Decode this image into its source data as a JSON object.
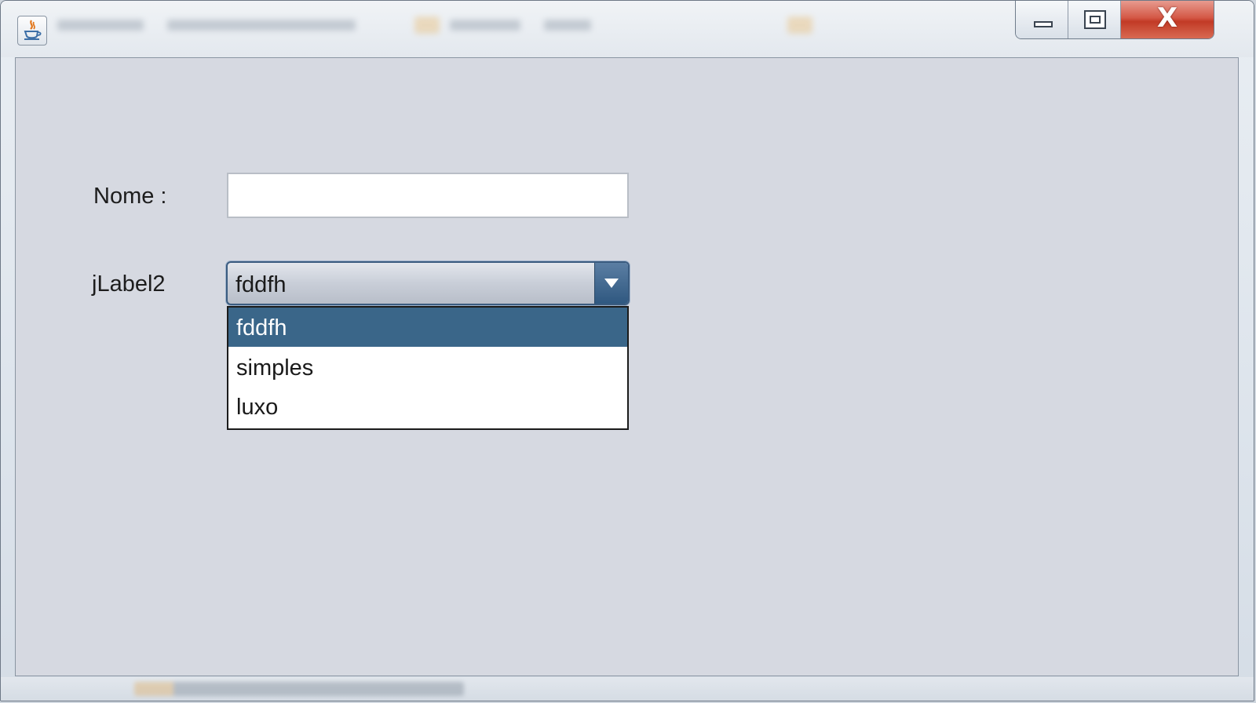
{
  "window": {
    "title": "",
    "caption_buttons": {
      "minimize": "minimize-icon",
      "maximize": "maximize-icon",
      "close": "close-icon",
      "close_symbol": "X"
    }
  },
  "form": {
    "name_label": "Nome :",
    "name_value": "",
    "combo_label": "jLabel2",
    "combo_selected": "fddfh",
    "combo_options": [
      "fddfh",
      "simples",
      "luxo"
    ],
    "highlighted_option": "fddfh"
  },
  "colors": {
    "panel_background": "#d6d9e1",
    "selection_background": "#3a6689",
    "close_button": "#c23a26"
  }
}
